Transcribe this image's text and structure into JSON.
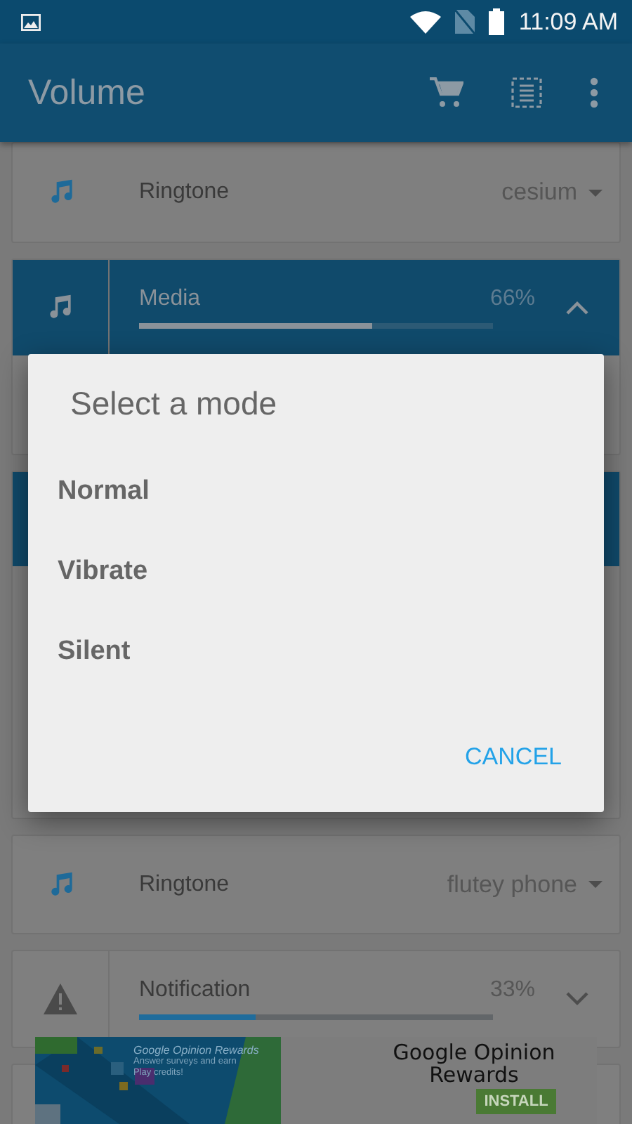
{
  "status_bar": {
    "time": "11:09 AM"
  },
  "app_bar": {
    "title": "Volume"
  },
  "cards": [
    {
      "kind": "ringtone",
      "label": "Ringtone",
      "value": "cesium"
    },
    {
      "kind": "media",
      "label": "Media",
      "reading": "66%",
      "level": 0.66,
      "expanded": true,
      "selected": true
    },
    {
      "kind": "blank",
      "selected": true
    },
    {
      "kind": "ringtone",
      "label": "Ringtone",
      "value": "flutey phone"
    },
    {
      "kind": "notification",
      "label": "Notification",
      "reading": "33%",
      "level": 0.33,
      "expanded": false,
      "selected": false
    },
    {
      "kind": "blank",
      "selected": false
    }
  ],
  "dialog": {
    "title": "Select a mode",
    "options": [
      "Normal",
      "Vibrate",
      "Silent"
    ],
    "cancel": "CANCEL"
  },
  "ad": {
    "headline": "Google Opinion Rewards",
    "tagline": "Answer surveys and earn Play credits!",
    "app_name": "Google Opinion Rewards",
    "install": "INSTALL"
  }
}
